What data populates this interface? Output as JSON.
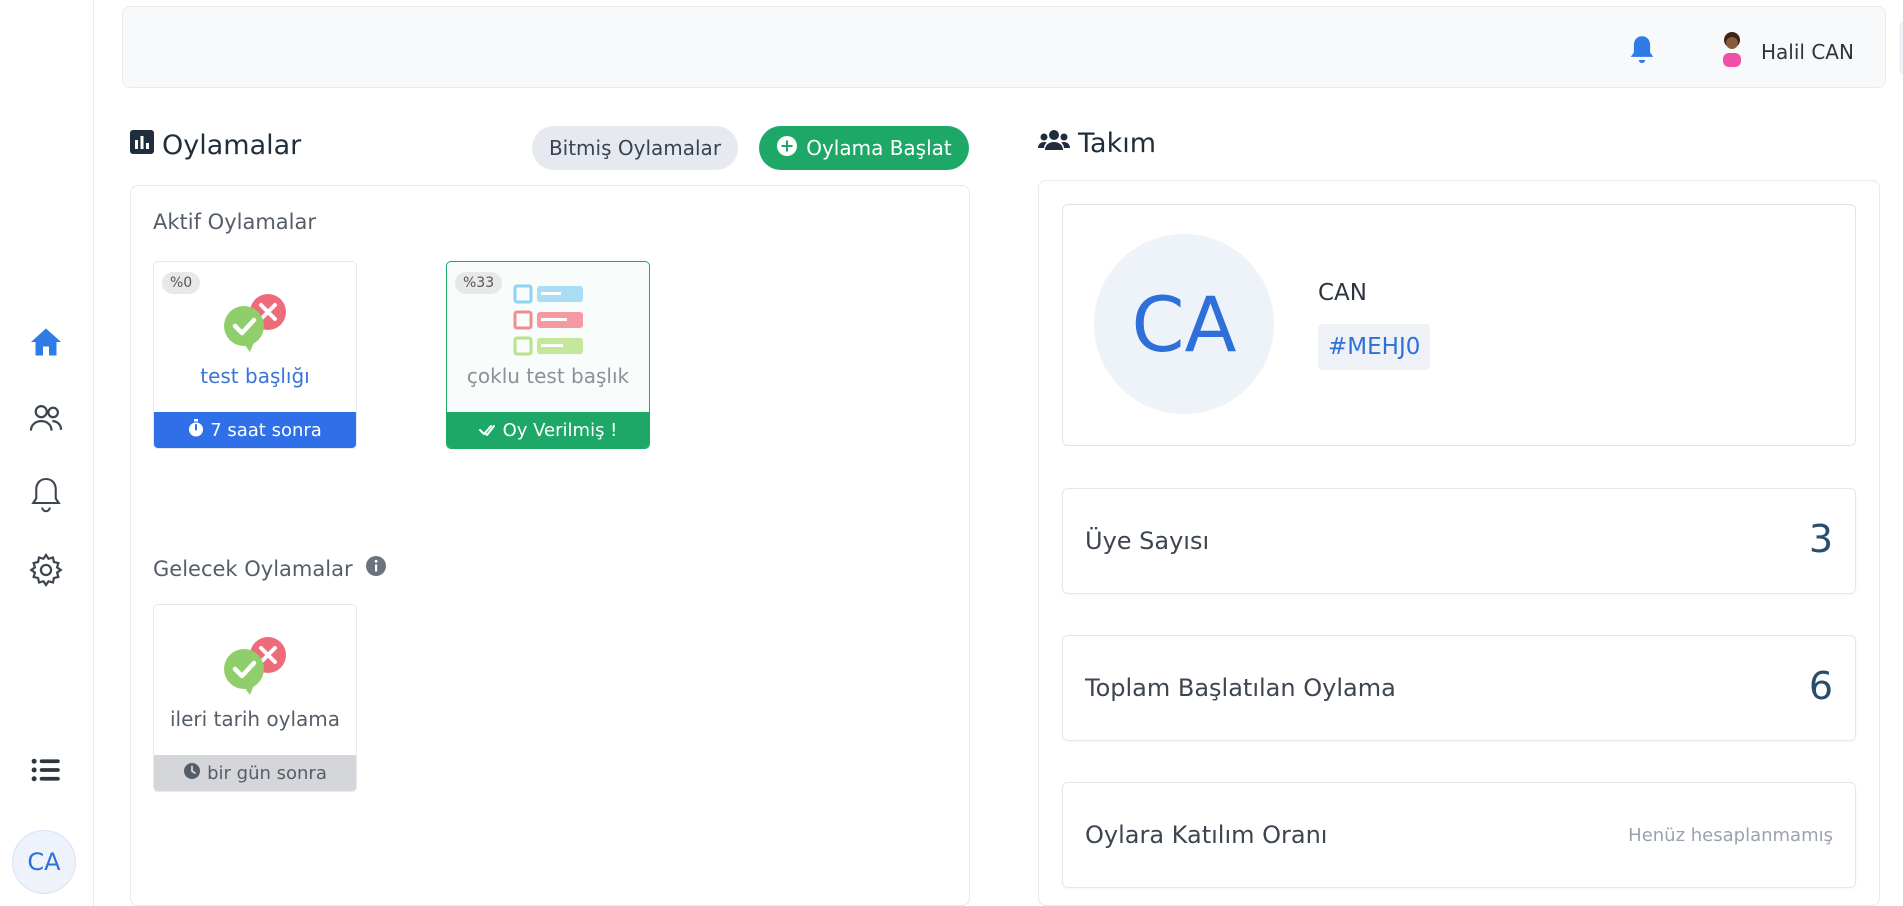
{
  "header": {
    "user_name": "Halil CAN",
    "lang": "tr"
  },
  "sidebar": {
    "items": [
      {
        "icon": "home-icon"
      },
      {
        "icon": "users-icon"
      },
      {
        "icon": "bell-icon"
      },
      {
        "icon": "gear-icon"
      },
      {
        "icon": "list-icon"
      }
    ],
    "avatar_initials": "CA"
  },
  "polls": {
    "title": "Oylamalar",
    "finished_button": "Bitmiş Oylamalar",
    "start_button": "Oylama Başlat",
    "active_title": "Aktif Oylamalar",
    "active": [
      {
        "percent": "%0",
        "name": "test başlığı",
        "footer": "7 saat sonra",
        "footer_color": "#2f6fe8",
        "name_color": "#3a73d9"
      },
      {
        "percent": "%33",
        "name": "çoklu test başlık",
        "footer": "Oy Verilmiş !",
        "footer_color": "#1ea868",
        "name_color": "#8a9199"
      }
    ],
    "upcoming_title": "Gelecek Oylamalar",
    "upcoming": [
      {
        "name": "ileri tarih oylama",
        "footer": "bir gün sonra",
        "footer_color": "#d4d6d9"
      }
    ]
  },
  "team": {
    "title": "Takım",
    "avatar_initials": "CA",
    "name": "CAN",
    "code": "#MEHJ0",
    "stats": [
      {
        "label": "Üye Sayısı",
        "value": "3"
      },
      {
        "label": "Toplam Başlatılan Oylama",
        "value": "6"
      },
      {
        "label": "Oylara Katılım Oranı",
        "value": "Henüz hesaplanmamış"
      }
    ]
  },
  "colors": {
    "accent_blue": "#2f6fe8",
    "accent_green": "#1ea868"
  }
}
